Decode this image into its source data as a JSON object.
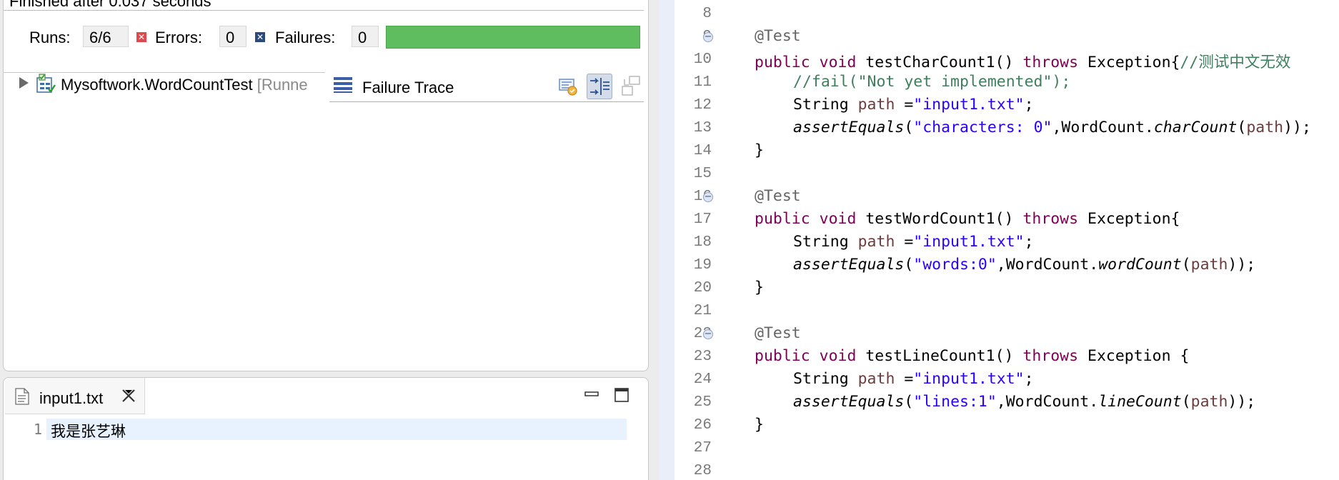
{
  "junit": {
    "finished": "Finished after 0.037 seconds",
    "runs_label": "Runs:",
    "runs_value": "6/6",
    "errors_label": "Errors:",
    "errors_value": "0",
    "failures_label": "Failures:",
    "failures_value": "0",
    "progress_fraction": 1.0,
    "progress_color": "#5fbd5f",
    "tree_item_name": "Mysoftwork.WordCountTest",
    "tree_item_runner": "[Runne",
    "trace_title": "Failure Trace",
    "icons": [
      "error-icon",
      "failure-icon",
      "expand-arrow-icon",
      "suite-icon",
      "stack-list-icon",
      "compare-icon",
      "filter-trace-icon",
      "copy-trace-icon"
    ]
  },
  "txt_editor": {
    "tab_label": "input1.txt",
    "line_number": "1",
    "line_text": "我是张艺琳",
    "icons": [
      "text-file-icon",
      "close-icon",
      "minimize-icon",
      "maximize-icon"
    ]
  },
  "java_editor": {
    "line_numbers": [
      "8",
      "9",
      "10",
      "11",
      "12",
      "13",
      "14",
      "15",
      "16",
      "17",
      "18",
      "19",
      "20",
      "21",
      "22",
      "23",
      "24",
      "25",
      "26",
      "27",
      "28"
    ],
    "fold_lines": [
      "9",
      "16",
      "22"
    ],
    "code": {
      "l9": "@Test",
      "l10_a": "public",
      "l10_b": "void",
      "l10_c": " testCharCount1() ",
      "l10_d": "throws",
      "l10_e": " Exception{",
      "l10_f": "//测试中文无效",
      "l11": "//fail(\"Not yet implemented\");",
      "l12_a": "String ",
      "l12_b": "path",
      "l12_c": " =",
      "l12_d": "\"input1.txt\"",
      "l12_e": ";",
      "l13_a": "assertEquals",
      "l13_b": "(",
      "l13_c": "\"characters: 0\"",
      "l13_d": ",WordCount.",
      "l13_e": "charCount",
      "l13_f": "(",
      "l13_g": "path",
      "l13_h": "));",
      "close_brace": "}",
      "l16": "@Test",
      "l17_c": " testWordCount1() ",
      "l17_e": " Exception{",
      "l19_c": "\"words:0\"",
      "l19_e": "wordCount",
      "l22": "@Test",
      "l23_c": " testLineCount1() ",
      "l23_e": " Exception {",
      "l25_c": "\"lines:1\"",
      "l25_e": "lineCount"
    }
  }
}
